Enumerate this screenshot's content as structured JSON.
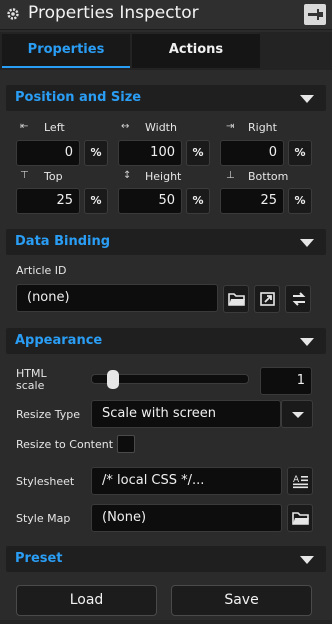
{
  "window": {
    "title": "Properties Inspector"
  },
  "tabs": [
    {
      "label": "Properties",
      "active": true
    },
    {
      "label": "Actions",
      "active": false
    }
  ],
  "position_size": {
    "header": "Position and Size",
    "left": {
      "label": "Left",
      "value": "0",
      "unit": "%"
    },
    "width": {
      "label": "Width",
      "value": "100",
      "unit": "%"
    },
    "right": {
      "label": "Right",
      "value": "0",
      "unit": "%"
    },
    "top": {
      "label": "Top",
      "value": "25",
      "unit": "%"
    },
    "height": {
      "label": "Height",
      "value": "50",
      "unit": "%"
    },
    "bottom": {
      "label": "Bottom",
      "value": "25",
      "unit": "%"
    }
  },
  "data_binding": {
    "header": "Data Binding",
    "article_label": "Article ID",
    "article_value": "(none)"
  },
  "appearance": {
    "header": "Appearance",
    "html_scale_label_1": "HTML",
    "html_scale_label_2": "scale",
    "html_scale_value": "1",
    "html_scale_slider_fraction": 0.1,
    "resize_type_label": "Resize Type",
    "resize_type_value": "Scale with screen",
    "resize_to_content_label": "Resize to Content",
    "resize_to_content_checked": false,
    "stylesheet_label": "Stylesheet",
    "stylesheet_value": "/* local CSS */...",
    "style_map_label": "Style Map",
    "style_map_value": "(None)"
  },
  "preset": {
    "header": "Preset",
    "load_label": "Load",
    "save_label": "Save"
  },
  "colors": {
    "accent": "#2a9df4",
    "panel": "#2b2b2b",
    "field": "#0d0d0d"
  }
}
